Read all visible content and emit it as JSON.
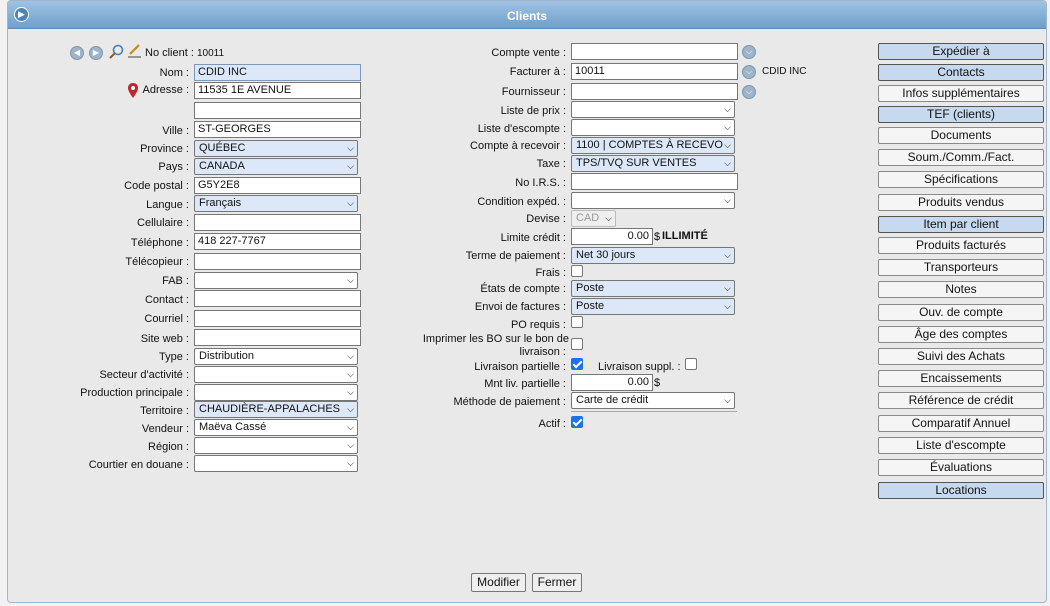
{
  "window": {
    "title": "Clients"
  },
  "nav": {
    "client_no_label": "No client :",
    "client_no": "10011"
  },
  "left": {
    "nom": {
      "label": "Nom :",
      "value": "CDID INC"
    },
    "adresse": {
      "label": "Adresse :",
      "value1": "11535 1E AVENUE",
      "value2": ""
    },
    "ville": {
      "label": "Ville :",
      "value": "ST-GEORGES"
    },
    "province": {
      "label": "Province :",
      "value": "QUÉBEC"
    },
    "pays": {
      "label": "Pays :",
      "value": "CANADA"
    },
    "code_postal": {
      "label": "Code postal :",
      "value": "G5Y2E8"
    },
    "langue": {
      "label": "Langue :",
      "value": "Français"
    },
    "cellulaire": {
      "label": "Cellulaire :",
      "value": ""
    },
    "telephone": {
      "label": "Téléphone :",
      "value": "418 227-7767"
    },
    "telecopieur": {
      "label": "Télécopieur :",
      "value": ""
    },
    "fab": {
      "label": "FAB :",
      "value": ""
    },
    "contact": {
      "label": "Contact :",
      "value": ""
    },
    "courriel": {
      "label": "Courriel :",
      "value": ""
    },
    "site_web": {
      "label": "Site web :",
      "value": ""
    },
    "type": {
      "label": "Type :",
      "value": "Distribution"
    },
    "secteur": {
      "label": "Secteur d'activité :",
      "value": ""
    },
    "production": {
      "label": "Production principale :",
      "value": ""
    },
    "territoire": {
      "label": "Territoire :",
      "value": "CHAUDIÈRE-APPALACHES"
    },
    "vendeur": {
      "label": "Vendeur :",
      "value": "Maëva Cassé"
    },
    "region": {
      "label": "Région :",
      "value": ""
    },
    "courtier": {
      "label": "Courtier en douane :",
      "value": ""
    }
  },
  "middle": {
    "compte_vente": {
      "label": "Compte vente :",
      "value": ""
    },
    "facturer": {
      "label": "Facturer à :",
      "value": "10011",
      "name": "CDID INC"
    },
    "fournisseur": {
      "label": "Fournisseur :",
      "value": ""
    },
    "liste_prix": {
      "label": "Liste de prix :",
      "value": ""
    },
    "liste_escompte": {
      "label": "Liste d'escompte :",
      "value": ""
    },
    "compte_recevoir": {
      "label": "Compte à recevoir :",
      "value": "1100 | COMPTES À RECEVO"
    },
    "taxe": {
      "label": "Taxe :",
      "value": "TPS/TVQ SUR VENTES"
    },
    "no_irs": {
      "label": "No I.R.S. :",
      "value": ""
    },
    "condition": {
      "label": "Condition expéd. :",
      "value": ""
    },
    "devise": {
      "label": "Devise :",
      "value": "CAD"
    },
    "limite": {
      "label": "Limite crédit :",
      "value": "0.00",
      "unit": "$",
      "note": "ILLIMITÉ"
    },
    "terme": {
      "label": "Terme de paiement :",
      "value": "Net 30 jours"
    },
    "frais": {
      "label": "Frais :"
    },
    "etats": {
      "label": "États de compte :",
      "value": "Poste"
    },
    "envoi": {
      "label": "Envoi de factures :",
      "value": "Poste"
    },
    "po_requis": {
      "label": "PO requis :"
    },
    "imprimer_bo": {
      "label1": "Imprimer les BO sur le bon de",
      "label2": "livraison :"
    },
    "livraison_partielle": {
      "label": "Livraison partielle :"
    },
    "livraison_suppl": {
      "label": "Livraison suppl. :"
    },
    "mnt_liv": {
      "label": "Mnt liv. partielle :",
      "value": "0.00",
      "unit": "$"
    },
    "methode": {
      "label": "Méthode de paiement :",
      "value": "Carte de crédit"
    },
    "actif": {
      "label": "Actif :"
    }
  },
  "side_buttons": [
    "Expédier à",
    "Contacts",
    "Infos supplémentaires",
    "TEF (clients)",
    "Documents",
    "Soum./Comm./Fact.",
    "Spécifications",
    "Produits vendus",
    "Item par client",
    "Produits facturés",
    "Transporteurs",
    "Notes",
    "Ouv. de compte",
    "Âge des comptes",
    "Suivi des Achats",
    "Encaissements",
    "Référence de crédit",
    "Comparatif Annuel",
    "Liste d'escompte",
    "Évaluations",
    "Locations"
  ],
  "actions": {
    "modifier": "Modifier",
    "fermer": "Fermer"
  }
}
